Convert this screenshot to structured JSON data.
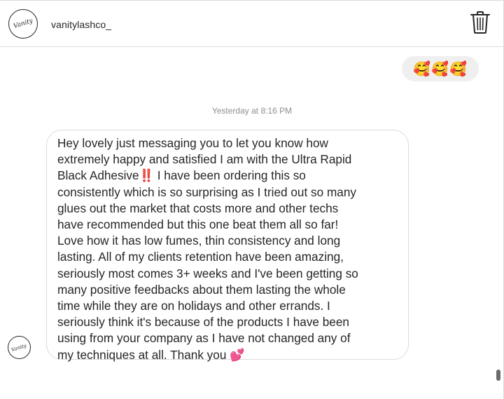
{
  "header": {
    "username": "vanitylashco_",
    "avatar_logo_text": "Vanity",
    "trash_icon": "trash-icon"
  },
  "reaction": {
    "emojis": "🥰🥰🥰"
  },
  "thread": {
    "timestamp": "Yesterday at 8:16 PM",
    "message": "Hey lovely just messaging you to let you know how\nextremely happy and satisfied I am with the Ultra Rapid\nBlack Adhesive‼️ I have been ordering this so\nconsistently which is so surprising as I tried out so many\nglues out the market that costs more and other techs\nhave  recommended but this one beat them all so far!\nLove how it has low fumes, thin consistency and long\nlasting. All of my clients retention have been amazing,\nseriously most comes 3+ weeks and I've been getting so\nmany positive feedbacks about them lasting the whole\ntime while they are on holidays and other errands. I\nseriously think it's because of the products I have been\nusing from your company as I have not changed any of\nmy techniques at all. Thank you 💕"
  }
}
